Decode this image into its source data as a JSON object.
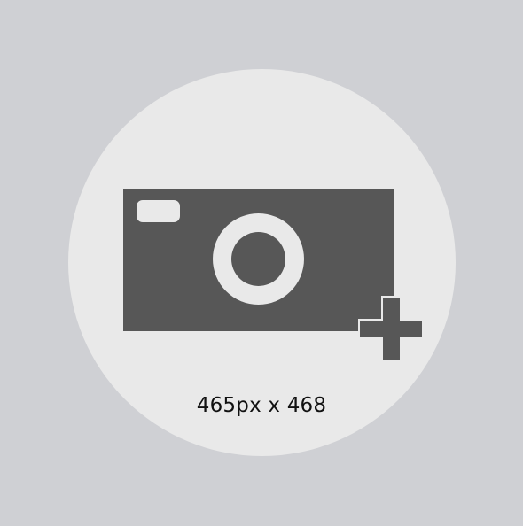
{
  "placeholder": {
    "dimensions_label": "465px x 468",
    "icon": "camera-add-icon"
  },
  "colors": {
    "background": "#cfd0d4",
    "circle": "#e9e9e9",
    "icon": "#575757",
    "text": "#111111"
  }
}
